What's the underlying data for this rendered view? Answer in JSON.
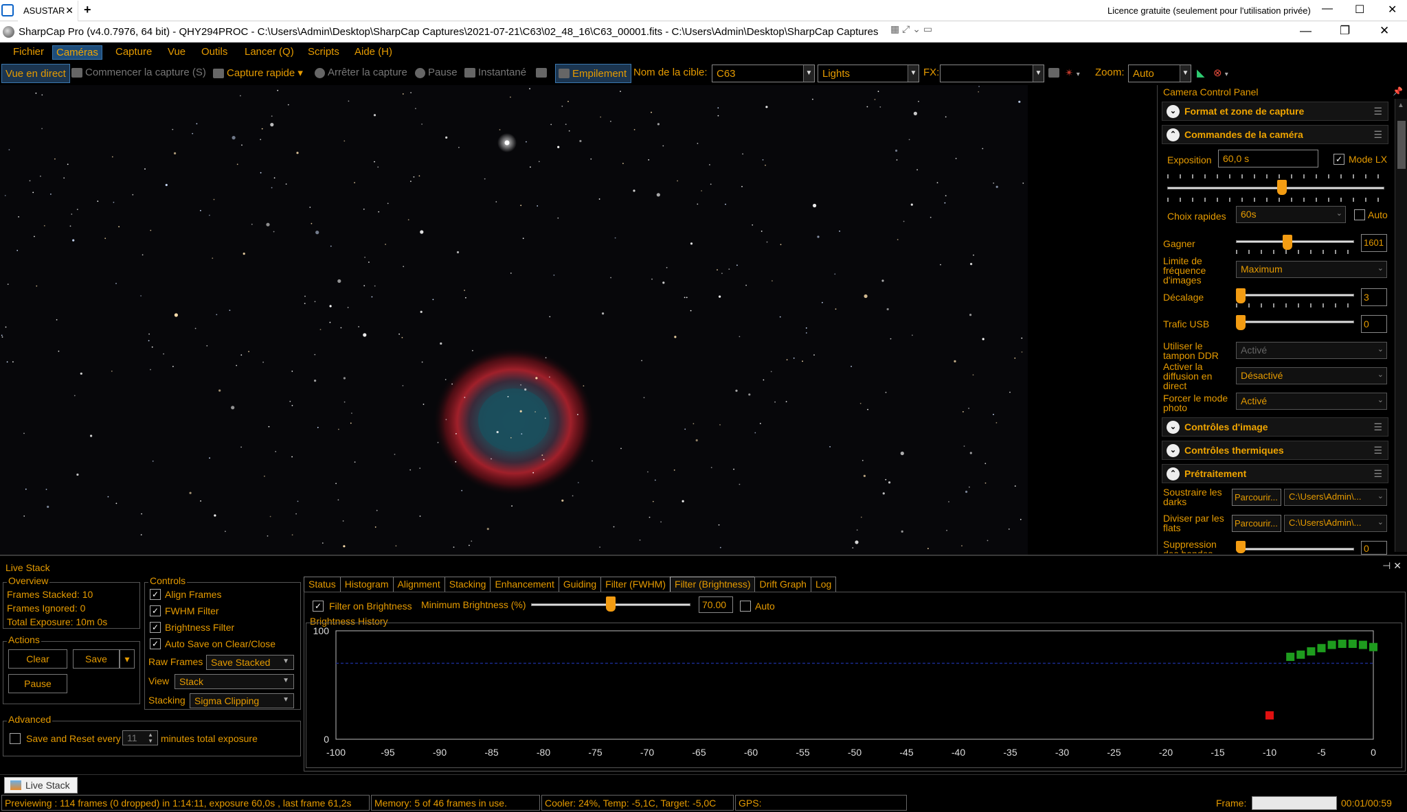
{
  "tabbar": {
    "tab_label": "ASUSTAR",
    "license": "Licence gratuite (seulement pour l'utilisation privée)"
  },
  "window": {
    "title": "SharpCap Pro (v4.0.7976, 64 bit) - QHY294PROC - C:\\Users\\Admin\\Desktop\\SharpCap Captures\\2021-07-21\\C63\\02_48_16\\C63_00001.fits - C:\\Users\\Admin\\Desktop\\SharpCap Captures"
  },
  "menu": {
    "items": [
      "Fichier",
      "Caméras",
      "Capture",
      "Vue",
      "Outils",
      "Lancer (Q)",
      "Scripts",
      "Aide (H)"
    ]
  },
  "toolbar": {
    "live_view": "Vue en direct",
    "start_capture": "Commencer la capture (S)",
    "quick_capture": "Capture rapide",
    "stop_capture": "Arrêter la capture",
    "pause": "Pause",
    "snapshot": "Instantané",
    "stacking": "Empilement",
    "target_label": "Nom de la cible:",
    "target_value": "C63",
    "frame_type": "Lights",
    "fx_label": "FX:",
    "fx_value": "",
    "zoom_label": "Zoom:",
    "zoom_value": "Auto"
  },
  "panel": {
    "title": "Camera Control Panel",
    "sections": {
      "format": "Format et zone de capture",
      "camera": "Commandes de la caméra",
      "image": "Contrôles d'image",
      "thermal": "Contrôles thermiques",
      "preprocessing": "Prétraitement"
    },
    "exposure_label": "Exposition",
    "exposure_value": "60,0 s",
    "lx_mode_label": "Mode LX",
    "quick_choice_label": "Choix rapides",
    "quick_choice_value": "60s",
    "auto_label": "Auto",
    "gain_label": "Gagner",
    "gain_value": "1601",
    "framerate_label": "Limite de fréquence d'images",
    "framerate_value": "Maximum",
    "offset_label": "Décalage",
    "offset_value": "3",
    "usb_label": "Trafic USB",
    "usb_value": "0",
    "ddr_label": "Utiliser le tampon DDR",
    "ddr_value": "Activé",
    "broadcast_label": "Activer la diffusion en direct",
    "broadcast_value": "Désactivé",
    "photo_label": "Forcer le mode photo",
    "photo_value": "Activé",
    "darks_label": "Soustraire les darks",
    "flats_label": "Diviser par les flats",
    "browse_label": "Parcourir...",
    "path_value": "C:\\Users\\Admin\\...",
    "banding_label": "Suppression des bandes",
    "banding_value": "0"
  },
  "livestack": {
    "title": "Live Stack",
    "overview": {
      "label": "Overview",
      "frames_stacked": "Frames Stacked:  10",
      "frames_ignored": "Frames Ignored:  0",
      "total_exposure": "Total Exposure:   10m 0s"
    },
    "actions": {
      "label": "Actions",
      "clear": "Clear",
      "save": "Save",
      "pause": "Pause"
    },
    "controls": {
      "label": "Controls",
      "align": "Align Frames",
      "fwhm": "FWHM Filter",
      "brightness": "Brightness Filter",
      "autosave": "Auto Save on Clear/Close",
      "raw_label": "Raw Frames",
      "raw_value": "Save Stacked",
      "view_label": "View",
      "view_value": "Stack",
      "stacking_label": "Stacking",
      "stacking_value": "Sigma Clipping"
    },
    "advanced": {
      "label": "Advanced",
      "save_reset": "Save and Reset every",
      "minutes_value": "11",
      "minutes_label": "minutes total exposure"
    },
    "tabs": [
      "Status",
      "Histogram",
      "Alignment",
      "Stacking",
      "Enhancement",
      "Guiding",
      "Filter (FWHM)",
      "Filter (Brightness)",
      "Drift Graph",
      "Log"
    ],
    "active_tab": "Filter (Brightness)",
    "filter_on_brightness": "Filter on Brightness",
    "min_brightness_label": "Minimum Brightness (%)",
    "min_brightness_value": "70.00",
    "min_brightness_level": 0.5,
    "auto_label": "Auto",
    "history_label": "Brightness History"
  },
  "chart_data": {
    "type": "scatter",
    "title": "Brightness History",
    "xlabel": "",
    "ylabel": "",
    "xlim": [
      -100,
      0
    ],
    "ylim": [
      0,
      100
    ],
    "x_ticks": [
      -100,
      -95,
      -90,
      -85,
      -80,
      -75,
      -70,
      -65,
      -60,
      -55,
      -50,
      -45,
      -40,
      -35,
      -30,
      -25,
      -20,
      -15,
      -10,
      -5,
      0
    ],
    "y_ticks": [
      0,
      100
    ],
    "threshold": 70,
    "series": [
      {
        "color": "#1e9c1e",
        "points": [
          [
            -8,
            76
          ],
          [
            -7,
            78
          ],
          [
            -6,
            81
          ],
          [
            -5,
            84
          ],
          [
            -4,
            87
          ],
          [
            -3,
            88
          ],
          [
            -2,
            88
          ],
          [
            -1,
            87
          ],
          [
            0,
            85
          ]
        ]
      },
      {
        "color": "#e01010",
        "points": [
          [
            -10,
            22
          ]
        ]
      }
    ]
  },
  "taskbar": {
    "item": "Live Stack"
  },
  "status": {
    "preview": "Previewing : 114 frames (0 dropped) in 1:14:11, exposure 60,0s , last frame 61,2s",
    "memory": "Memory: 5 of 46 frames in use.",
    "cooler": "Cooler: 24%, Temp: -5,1C, Target: -5,0C",
    "gps": "GPS:",
    "frame_label": "Frame:",
    "time": "00:01/00:59"
  },
  "colors": {
    "accent": "#e69b00",
    "background": "#000000",
    "threshold_line": "#1a2a8a"
  }
}
